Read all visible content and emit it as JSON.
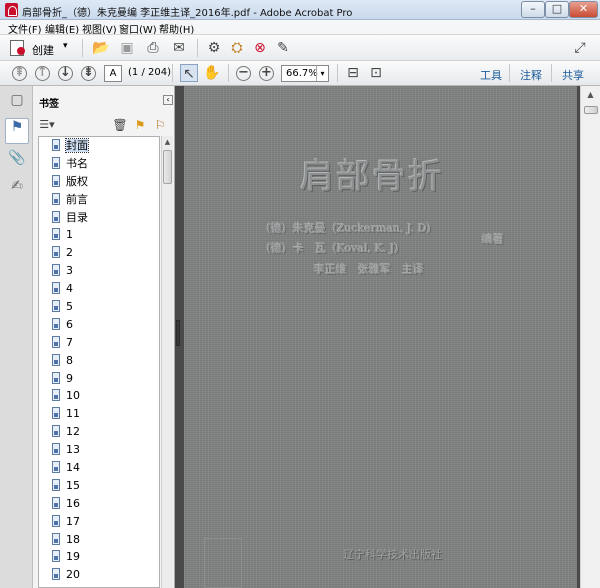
{
  "window": {
    "title": "肩部骨折_（德）朱克曼编 李正维主译_2016年.pdf - Adobe Acrobat Pro",
    "minimize": "–",
    "maximize": "□",
    "close": "✕"
  },
  "menu": [
    "文件(F)",
    "编辑(E)",
    "视图(V)",
    "窗口(W)",
    "帮助(H)"
  ],
  "toolbar": {
    "create_label": "创建",
    "page_current": "A",
    "page_count": "(1 / 204)",
    "zoom": "66.7%",
    "tools_link": "工具",
    "comment_link": "注释",
    "share_link": "共享"
  },
  "bookmarks": {
    "title": "书签",
    "items": [
      "封面",
      "书名",
      "版权",
      "前言",
      "目录",
      "1",
      "2",
      "3",
      "4",
      "5",
      "6",
      "7",
      "8",
      "9",
      "10",
      "11",
      "12",
      "13",
      "14",
      "15",
      "16",
      "17",
      "18",
      "19",
      "20"
    ],
    "selected_index": 0
  },
  "document": {
    "book_title": "肩部骨折",
    "author1": "（德）朱克曼（Zuckerman, J. D）",
    "author2": "（德）卡　瓦（Koval, K. J）",
    "author_role": "编著",
    "translators": "李正维　张雅军　主译",
    "publisher": "辽宁科学技术出版社"
  },
  "icons": {
    "open": "folder-open-icon",
    "save": "save-icon",
    "print": "print-icon",
    "email": "email-icon",
    "settings": "gear-icon",
    "select": "select-arrow-icon",
    "hand": "hand-icon"
  }
}
